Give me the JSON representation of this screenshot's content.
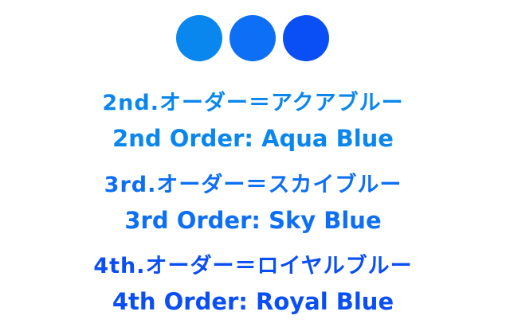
{
  "dots": [
    {
      "color": "#0a87ef"
    },
    {
      "color": "#0d6ff5"
    },
    {
      "color": "#0a4ef5"
    }
  ],
  "orders": [
    {
      "jp": "2nd.オーダー＝アクアブルー",
      "en": "2nd Order: Aqua Blue",
      "color": "#0a87ef"
    },
    {
      "jp": "3rd.オーダー＝スカイブルー",
      "en": "3rd Order: Sky Blue",
      "color": "#0d6ff5"
    },
    {
      "jp": "4th.オーダー＝ロイヤルブルー",
      "en": "4th Order: Royal Blue",
      "color": "#0a4ef5"
    }
  ]
}
